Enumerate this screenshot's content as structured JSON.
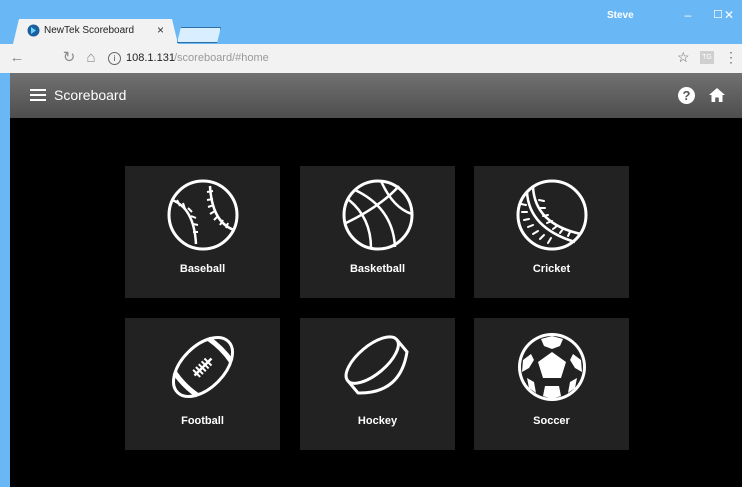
{
  "browser": {
    "tab_title": "NewTek Scoreboard",
    "tab_close": "×",
    "user": "Steve",
    "window_controls": [
      "–",
      "☐",
      "✕"
    ],
    "address": {
      "host": "108.1.131",
      "path": "/scoreboard/#home"
    },
    "extension_label": "TG"
  },
  "app": {
    "title": "Scoreboard",
    "help_icon": "?"
  },
  "sports": [
    {
      "label": "Baseball",
      "icon": "baseball-icon"
    },
    {
      "label": "Basketball",
      "icon": "basketball-icon"
    },
    {
      "label": "Cricket",
      "icon": "cricket-ball-icon"
    },
    {
      "label": "Football",
      "icon": "football-icon"
    },
    {
      "label": "Hockey",
      "icon": "hockey-puck-icon"
    },
    {
      "label": "Soccer",
      "icon": "soccer-ball-icon"
    }
  ],
  "colors": {
    "chrome_blue": "#69b8f5",
    "header_gray": "#5e5e5e",
    "tile_bg": "#222222",
    "main_bg": "#000000"
  }
}
